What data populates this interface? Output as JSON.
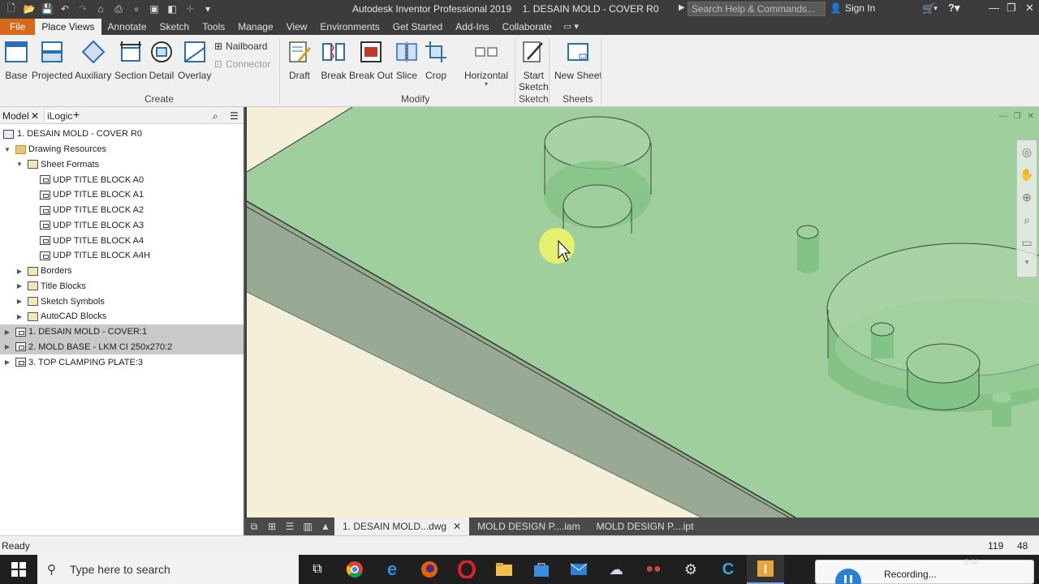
{
  "titlebar": {
    "app_title": "Autodesk Inventor Professional 2019",
    "doc_title": "1. DESAIN MOLD - COVER R0",
    "search_placeholder": "Search Help & Commands...",
    "sign_in": "Sign In"
  },
  "tabs": [
    "File",
    "Place Views",
    "Annotate",
    "Sketch",
    "Tools",
    "Manage",
    "View",
    "Environments",
    "Get Started",
    "Add-Ins",
    "Collaborate"
  ],
  "active_tab": "Place Views",
  "ribbon": {
    "create": {
      "title": "Create",
      "buttons": [
        "Base",
        "Projected",
        "Auxiliary",
        "Section",
        "Detail",
        "Overlay"
      ],
      "small": [
        "Nailboard",
        "Connector"
      ]
    },
    "modify": {
      "title": "Modify",
      "buttons": [
        "Draft",
        "Break",
        "Break Out",
        "Slice",
        "Crop",
        "Horizontal"
      ]
    },
    "sketch": {
      "title": "Sketch",
      "button": "Start\nSketch"
    },
    "sheets": {
      "title": "Sheets",
      "button": "New Sheet"
    }
  },
  "browser": {
    "tab_model": "Model",
    "tab_ilogic": "iLogic",
    "tree": [
      {
        "label": "1. DESAIN MOLD - COVER R0",
        "level": 0,
        "icon": "doc",
        "expander": ""
      },
      {
        "label": "Drawing Resources",
        "level": 0,
        "icon": "folder",
        "expander": "open"
      },
      {
        "label": "Sheet Formats",
        "level": 1,
        "icon": "fmt",
        "expander": "open"
      },
      {
        "label": "UDP TITLE BLOCK A0",
        "level": 2,
        "icon": "sheet",
        "expander": ""
      },
      {
        "label": "UDP TITLE BLOCK A1",
        "level": 2,
        "icon": "sheet",
        "expander": ""
      },
      {
        "label": "UDP TITLE BLOCK A2",
        "level": 2,
        "icon": "sheet",
        "expander": ""
      },
      {
        "label": "UDP TITLE BLOCK A3",
        "level": 2,
        "icon": "sheet",
        "expander": ""
      },
      {
        "label": "UDP TITLE BLOCK A4",
        "level": 2,
        "icon": "sheet",
        "expander": ""
      },
      {
        "label": "UDP TITLE BLOCK A4H",
        "level": 2,
        "icon": "sheet",
        "expander": ""
      },
      {
        "label": "Borders",
        "level": 1,
        "icon": "fmt",
        "expander": "closed"
      },
      {
        "label": "Title Blocks",
        "level": 1,
        "icon": "fmt",
        "expander": "closed"
      },
      {
        "label": "Sketch Symbols",
        "level": 1,
        "icon": "fmt",
        "expander": "closed"
      },
      {
        "label": "AutoCAD Blocks",
        "level": 1,
        "icon": "fmt",
        "expander": "closed"
      },
      {
        "label": "1. DESAIN MOLD - COVER:1",
        "level": 0,
        "icon": "sheet",
        "expander": "closed",
        "selected": true
      },
      {
        "label": "2. MOLD BASE - LKM CI 250x270:2",
        "level": 0,
        "icon": "sheet",
        "expander": "closed",
        "selected": true
      },
      {
        "label": "3. TOP CLAMPING PLATE:3",
        "level": 0,
        "icon": "sheet",
        "expander": "closed"
      }
    ]
  },
  "doc_tabs": [
    {
      "label": "1. DESAIN MOLD...dwg",
      "active": true
    },
    {
      "label": "MOLD DESIGN P....iam",
      "active": false
    },
    {
      "label": "MOLD DESIGN P....ipt",
      "active": false
    }
  ],
  "status": {
    "text": "Ready",
    "num1": "119",
    "num2": "48"
  },
  "taskbar": {
    "search_placeholder": "Type here to search",
    "recording": "Recording...",
    "clock": "8:44"
  },
  "colors": {
    "accent": "#d7671b",
    "part_green": "#9fcf9c",
    "paper": "#f3efd8",
    "edge_dark": "#7a957a"
  }
}
